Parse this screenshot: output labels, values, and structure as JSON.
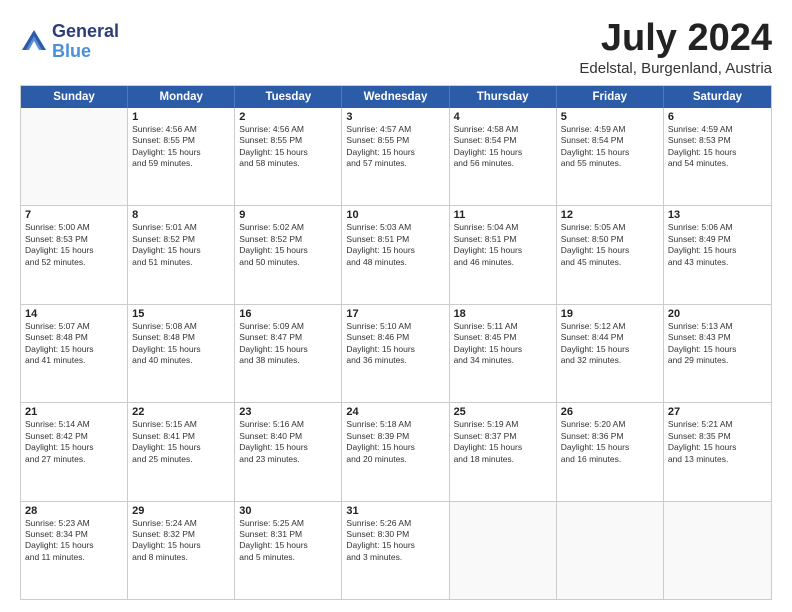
{
  "header": {
    "logo_line1": "General",
    "logo_line2": "Blue",
    "month": "July 2024",
    "location": "Edelstal, Burgenland, Austria"
  },
  "weekdays": [
    "Sunday",
    "Monday",
    "Tuesday",
    "Wednesday",
    "Thursday",
    "Friday",
    "Saturday"
  ],
  "rows": [
    [
      {
        "day": "",
        "lines": []
      },
      {
        "day": "1",
        "lines": [
          "Sunrise: 4:56 AM",
          "Sunset: 8:55 PM",
          "Daylight: 15 hours",
          "and 59 minutes."
        ]
      },
      {
        "day": "2",
        "lines": [
          "Sunrise: 4:56 AM",
          "Sunset: 8:55 PM",
          "Daylight: 15 hours",
          "and 58 minutes."
        ]
      },
      {
        "day": "3",
        "lines": [
          "Sunrise: 4:57 AM",
          "Sunset: 8:55 PM",
          "Daylight: 15 hours",
          "and 57 minutes."
        ]
      },
      {
        "day": "4",
        "lines": [
          "Sunrise: 4:58 AM",
          "Sunset: 8:54 PM",
          "Daylight: 15 hours",
          "and 56 minutes."
        ]
      },
      {
        "day": "5",
        "lines": [
          "Sunrise: 4:59 AM",
          "Sunset: 8:54 PM",
          "Daylight: 15 hours",
          "and 55 minutes."
        ]
      },
      {
        "day": "6",
        "lines": [
          "Sunrise: 4:59 AM",
          "Sunset: 8:53 PM",
          "Daylight: 15 hours",
          "and 54 minutes."
        ]
      }
    ],
    [
      {
        "day": "7",
        "lines": [
          "Sunrise: 5:00 AM",
          "Sunset: 8:53 PM",
          "Daylight: 15 hours",
          "and 52 minutes."
        ]
      },
      {
        "day": "8",
        "lines": [
          "Sunrise: 5:01 AM",
          "Sunset: 8:52 PM",
          "Daylight: 15 hours",
          "and 51 minutes."
        ]
      },
      {
        "day": "9",
        "lines": [
          "Sunrise: 5:02 AM",
          "Sunset: 8:52 PM",
          "Daylight: 15 hours",
          "and 50 minutes."
        ]
      },
      {
        "day": "10",
        "lines": [
          "Sunrise: 5:03 AM",
          "Sunset: 8:51 PM",
          "Daylight: 15 hours",
          "and 48 minutes."
        ]
      },
      {
        "day": "11",
        "lines": [
          "Sunrise: 5:04 AM",
          "Sunset: 8:51 PM",
          "Daylight: 15 hours",
          "and 46 minutes."
        ]
      },
      {
        "day": "12",
        "lines": [
          "Sunrise: 5:05 AM",
          "Sunset: 8:50 PM",
          "Daylight: 15 hours",
          "and 45 minutes."
        ]
      },
      {
        "day": "13",
        "lines": [
          "Sunrise: 5:06 AM",
          "Sunset: 8:49 PM",
          "Daylight: 15 hours",
          "and 43 minutes."
        ]
      }
    ],
    [
      {
        "day": "14",
        "lines": [
          "Sunrise: 5:07 AM",
          "Sunset: 8:48 PM",
          "Daylight: 15 hours",
          "and 41 minutes."
        ]
      },
      {
        "day": "15",
        "lines": [
          "Sunrise: 5:08 AM",
          "Sunset: 8:48 PM",
          "Daylight: 15 hours",
          "and 40 minutes."
        ]
      },
      {
        "day": "16",
        "lines": [
          "Sunrise: 5:09 AM",
          "Sunset: 8:47 PM",
          "Daylight: 15 hours",
          "and 38 minutes."
        ]
      },
      {
        "day": "17",
        "lines": [
          "Sunrise: 5:10 AM",
          "Sunset: 8:46 PM",
          "Daylight: 15 hours",
          "and 36 minutes."
        ]
      },
      {
        "day": "18",
        "lines": [
          "Sunrise: 5:11 AM",
          "Sunset: 8:45 PM",
          "Daylight: 15 hours",
          "and 34 minutes."
        ]
      },
      {
        "day": "19",
        "lines": [
          "Sunrise: 5:12 AM",
          "Sunset: 8:44 PM",
          "Daylight: 15 hours",
          "and 32 minutes."
        ]
      },
      {
        "day": "20",
        "lines": [
          "Sunrise: 5:13 AM",
          "Sunset: 8:43 PM",
          "Daylight: 15 hours",
          "and 29 minutes."
        ]
      }
    ],
    [
      {
        "day": "21",
        "lines": [
          "Sunrise: 5:14 AM",
          "Sunset: 8:42 PM",
          "Daylight: 15 hours",
          "and 27 minutes."
        ]
      },
      {
        "day": "22",
        "lines": [
          "Sunrise: 5:15 AM",
          "Sunset: 8:41 PM",
          "Daylight: 15 hours",
          "and 25 minutes."
        ]
      },
      {
        "day": "23",
        "lines": [
          "Sunrise: 5:16 AM",
          "Sunset: 8:40 PM",
          "Daylight: 15 hours",
          "and 23 minutes."
        ]
      },
      {
        "day": "24",
        "lines": [
          "Sunrise: 5:18 AM",
          "Sunset: 8:39 PM",
          "Daylight: 15 hours",
          "and 20 minutes."
        ]
      },
      {
        "day": "25",
        "lines": [
          "Sunrise: 5:19 AM",
          "Sunset: 8:37 PM",
          "Daylight: 15 hours",
          "and 18 minutes."
        ]
      },
      {
        "day": "26",
        "lines": [
          "Sunrise: 5:20 AM",
          "Sunset: 8:36 PM",
          "Daylight: 15 hours",
          "and 16 minutes."
        ]
      },
      {
        "day": "27",
        "lines": [
          "Sunrise: 5:21 AM",
          "Sunset: 8:35 PM",
          "Daylight: 15 hours",
          "and 13 minutes."
        ]
      }
    ],
    [
      {
        "day": "28",
        "lines": [
          "Sunrise: 5:23 AM",
          "Sunset: 8:34 PM",
          "Daylight: 15 hours",
          "and 11 minutes."
        ]
      },
      {
        "day": "29",
        "lines": [
          "Sunrise: 5:24 AM",
          "Sunset: 8:32 PM",
          "Daylight: 15 hours",
          "and 8 minutes."
        ]
      },
      {
        "day": "30",
        "lines": [
          "Sunrise: 5:25 AM",
          "Sunset: 8:31 PM",
          "Daylight: 15 hours",
          "and 5 minutes."
        ]
      },
      {
        "day": "31",
        "lines": [
          "Sunrise: 5:26 AM",
          "Sunset: 8:30 PM",
          "Daylight: 15 hours",
          "and 3 minutes."
        ]
      },
      {
        "day": "",
        "lines": []
      },
      {
        "day": "",
        "lines": []
      },
      {
        "day": "",
        "lines": []
      }
    ]
  ]
}
